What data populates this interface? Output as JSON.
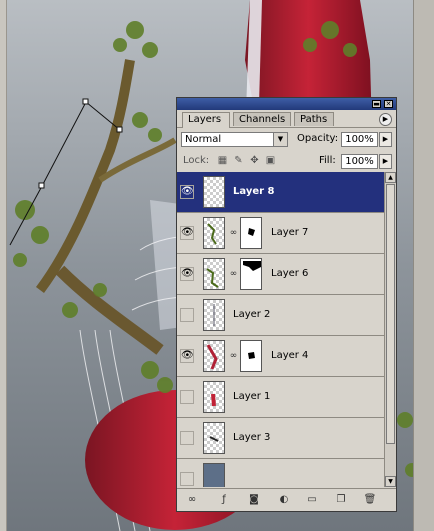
{
  "palette": {
    "tabs": [
      "Layers",
      "Channels",
      "Paths"
    ],
    "blend_mode": "Normal",
    "opacity_label": "Opacity:",
    "opacity_value": "100%",
    "lock_label": "Lock:",
    "fill_label": "Fill:",
    "fill_value": "100%",
    "layers": [
      {
        "name": "Layer 8",
        "visible": true,
        "selected": true,
        "has_mask": false
      },
      {
        "name": "Layer 7",
        "visible": true,
        "selected": false,
        "has_mask": true
      },
      {
        "name": "Layer 6",
        "visible": true,
        "selected": false,
        "has_mask": true
      },
      {
        "name": "Layer 2",
        "visible": false,
        "selected": false,
        "has_mask": false
      },
      {
        "name": "Layer 4",
        "visible": true,
        "selected": false,
        "has_mask": true
      },
      {
        "name": "Layer 1",
        "visible": false,
        "selected": false,
        "has_mask": false
      },
      {
        "name": "Layer 3",
        "visible": false,
        "selected": false,
        "has_mask": false
      }
    ],
    "icons": {
      "eye": "eye-icon",
      "chain": "link-icon",
      "bottom": [
        "link-layers-icon",
        "layer-style-icon",
        "add-mask-icon",
        "adjustment-layer-icon",
        "new-group-icon",
        "new-layer-icon",
        "trash-icon"
      ]
    },
    "colors": {
      "selection": "#23307d",
      "titlebar": "#2d4a92"
    }
  }
}
